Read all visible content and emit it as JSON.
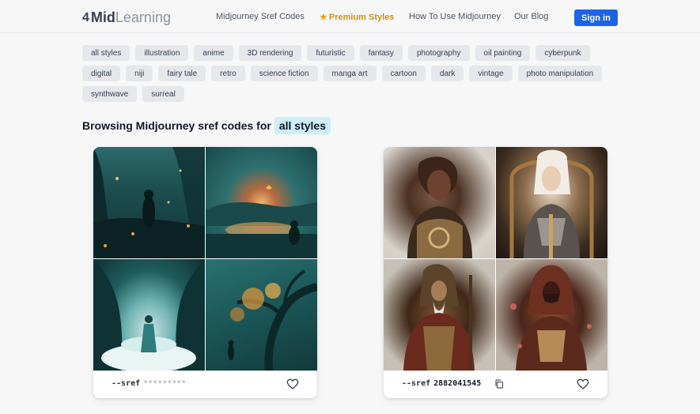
{
  "header": {
    "logo_mark": "4",
    "logo_mid": "Mid",
    "logo_learning": "Learning",
    "nav": [
      {
        "label": "Midjourney Sref Codes"
      },
      {
        "label": "Premium Styles"
      },
      {
        "label": "How To Use Midjourney"
      },
      {
        "label": "Our Blog"
      }
    ],
    "signin_label": "Sign in"
  },
  "tags": [
    "all styles",
    "illustration",
    "anime",
    "3D rendering",
    "futuristic",
    "fantasy",
    "photography",
    "oil painting",
    "cyberpunk",
    "digital",
    "niji",
    "fairy tale",
    "retro",
    "science fiction",
    "manga art",
    "cartoon",
    "dark",
    "vintage",
    "photo manipulation",
    "synthwave",
    "surreal"
  ],
  "heading": {
    "prefix": "Browsing Midjourney sref codes for",
    "highlight": "all styles"
  },
  "cards": [
    {
      "sref_label": "--sref",
      "code": "*********"
    },
    {
      "sref_label": "--sref",
      "code": "2882041545"
    }
  ],
  "colors": {
    "accent": "#1d63e6",
    "premium": "#c8921a",
    "highlight_bg": "#cdeff6"
  },
  "icons": [
    "logo-mark-icon",
    "star-icon",
    "copy-icon",
    "heart-icon"
  ]
}
